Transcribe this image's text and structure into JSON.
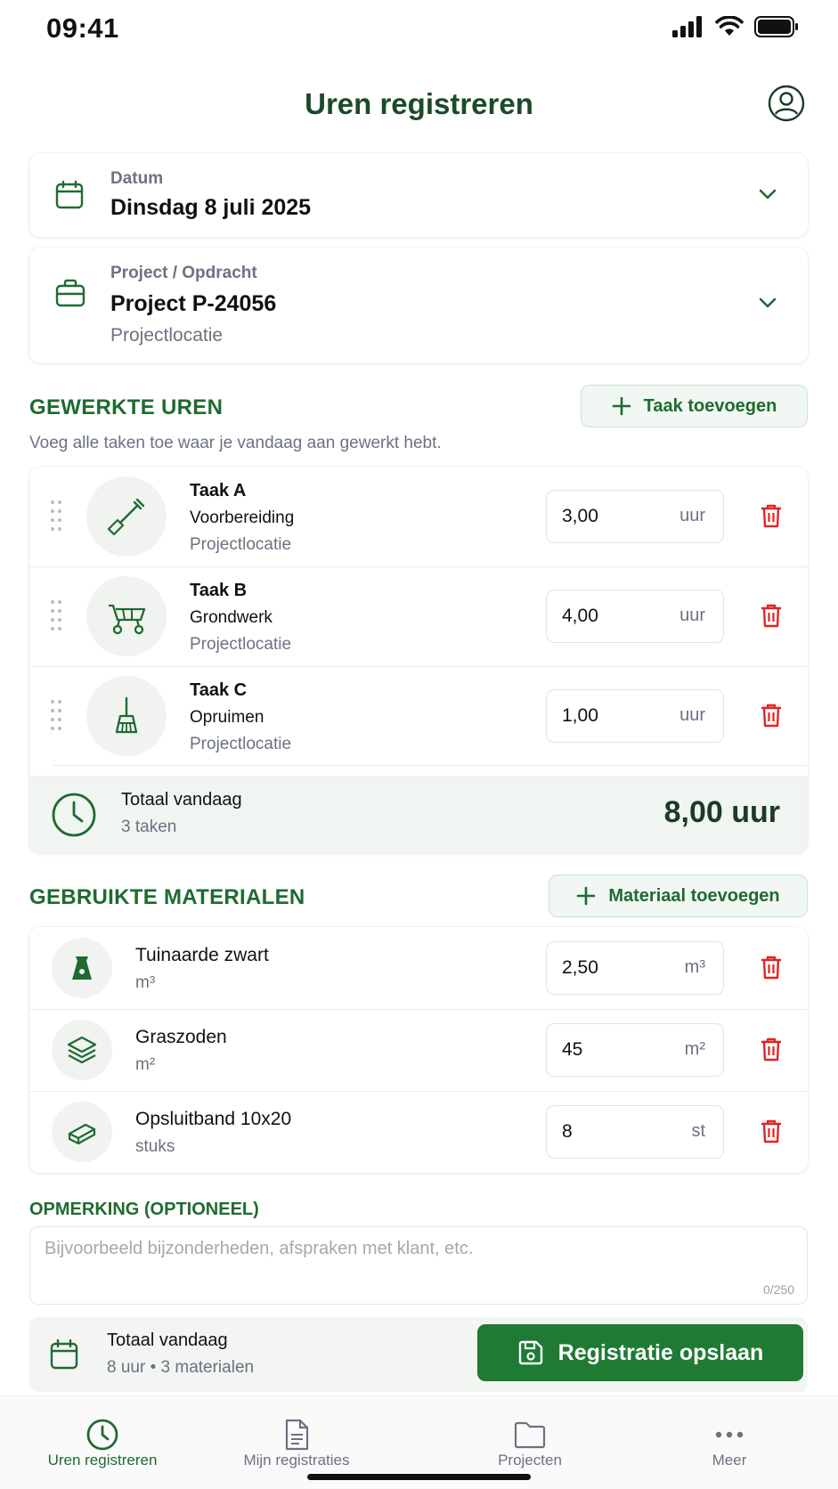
{
  "status_bar": {
    "time": "09:41"
  },
  "header": {
    "title": "Uren registreren"
  },
  "date_field": {
    "label": "Datum",
    "value": "Dinsdag 8 juli 2025"
  },
  "project_field": {
    "label": "Project / Opdracht",
    "value": "Project P-24056",
    "location": "Projectlocatie"
  },
  "hours_section": {
    "title": "GEWERKTE UREN",
    "subtitle": "Voeg alle taken toe waar je vandaag aan gewerkt hebt.",
    "add_label": "Taak toevoegen",
    "tasks": [
      {
        "name": "Taak A",
        "activity": "Voorbereiding",
        "location": "Projectlocatie",
        "hours": "3,00",
        "unit": "uur",
        "icon": "shovel-icon"
      },
      {
        "name": "Taak B",
        "activity": "Grondwerk",
        "location": "Projectlocatie",
        "hours": "4,00",
        "unit": "uur",
        "icon": "wheelbarrow-icon"
      },
      {
        "name": "Taak C",
        "activity": "Opruimen",
        "location": "Projectlocatie",
        "hours": "1,00",
        "unit": "uur",
        "icon": "broom-icon"
      }
    ],
    "total": {
      "label": "Totaal vandaag",
      "count": "3 taken",
      "value": "8,00 uur"
    }
  },
  "materials_section": {
    "title": "GEBRUIKTE MATERIALEN",
    "add_label": "Materiaal toevoegen",
    "items": [
      {
        "name": "Tuinaarde zwart",
        "unit_label": "m³",
        "qty": "2,50",
        "unit": "m³",
        "icon": "soil-bag-icon"
      },
      {
        "name": "Graszoden",
        "unit_label": "m²",
        "qty": "45",
        "unit": "m²",
        "icon": "layers-icon"
      },
      {
        "name": "Opsluitband 10x20",
        "unit_label": "stuks",
        "qty": "8",
        "unit": "st",
        "icon": "block-icon"
      }
    ]
  },
  "remark": {
    "title": "OPMERKING (OPTIONEEL)",
    "placeholder": "Bijvoorbeeld bijzonderheden, afspraken met klant, etc.",
    "counter": "0/250"
  },
  "summary": {
    "label": "Totaal vandaag",
    "detail": "8 uur • 3 materialen",
    "save_label": "Registratie opslaan"
  },
  "bottom_nav": {
    "items": [
      {
        "label": "Uren registreren",
        "icon": "clock-icon",
        "active": true
      },
      {
        "label": "Mijn registraties",
        "icon": "document-icon",
        "active": false
      },
      {
        "label": "Projecten",
        "icon": "folder-icon",
        "active": false
      },
      {
        "label": "Meer",
        "icon": "more-icon",
        "active": false
      }
    ]
  },
  "colors": {
    "primary": "#1e6b30",
    "primary_dark": "#1c4a28",
    "danger": "#e02424",
    "save_button": "#1f7a33"
  }
}
